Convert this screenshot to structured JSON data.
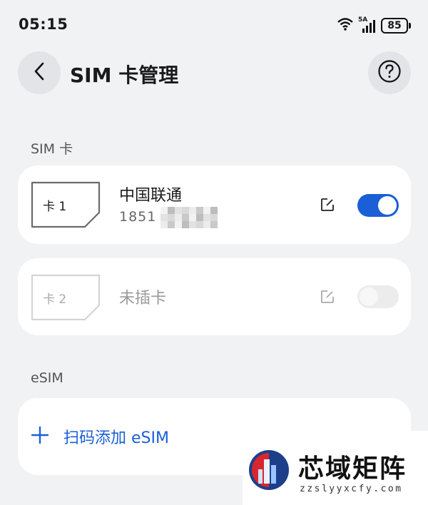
{
  "status_bar": {
    "time": "05:15",
    "network": "5A",
    "battery": "85"
  },
  "header": {
    "title": "SIM 卡管理"
  },
  "sim_section": {
    "label": "SIM 卡",
    "cards": [
      {
        "slot": "卡 1",
        "carrier": "中国联通",
        "number": "1851",
        "enabled": true
      },
      {
        "slot": "卡 2",
        "carrier": "未插卡",
        "number": "",
        "enabled": false
      }
    ]
  },
  "esim_section": {
    "label": "eSIM",
    "add_label": "扫码添加 eSIM"
  },
  "watermark": {
    "title": "芯域矩阵",
    "url": "zzslyyxcfy.com"
  },
  "colors": {
    "accent": "#1a5fd6",
    "background": "#f1f2f4",
    "card": "#ffffff"
  }
}
